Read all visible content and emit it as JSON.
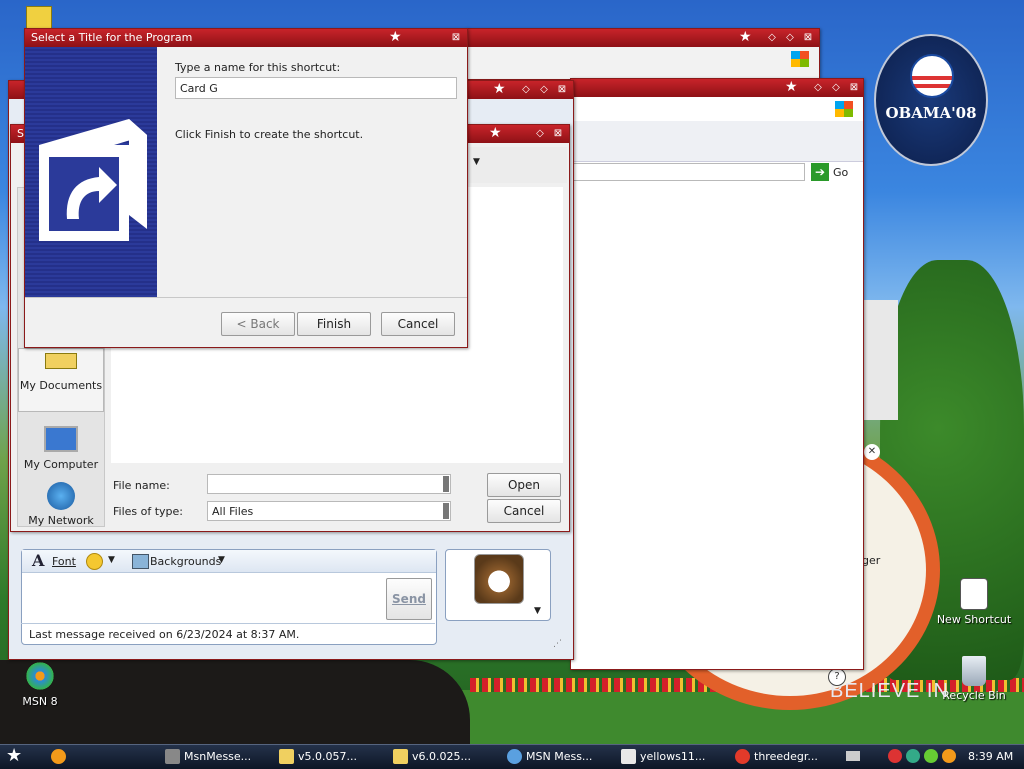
{
  "desktop": {
    "icons": [
      {
        "label": "MSN 8"
      },
      {
        "label": "New Shortcut"
      },
      {
        "label": "Recycle Bin"
      }
    ],
    "obama_badge": {
      "text": "OBAMA'08"
    },
    "side_text": "ger",
    "bottom_banner": "BELIEVE IN"
  },
  "wizard": {
    "title": "Select a Title for the Program",
    "prompt": "Type a name for this shortcut:",
    "name_value": "Card G",
    "hint": "Click Finish to create the shortcut.",
    "back_label": "< Back",
    "finish_label": "Finish",
    "cancel_label": "Cancel"
  },
  "browser": {
    "go_label": "Go"
  },
  "open_dialog": {
    "title_stub": "Se",
    "places": [
      {
        "label": "My Documents"
      },
      {
        "label": "My Computer"
      },
      {
        "label": "My Network"
      }
    ],
    "file_name_label": "File name:",
    "file_name_value": "",
    "files_of_type_label": "Files of type:",
    "files_of_type_value": "All Files",
    "open_label": "Open",
    "cancel_label": "Cancel"
  },
  "messenger": {
    "font_label": "Font",
    "backgrounds_label": "Backgrounds",
    "send_label": "Send",
    "status": "Last message received on 6/23/2024 at 8:37 AM."
  },
  "taskbar": {
    "items": [
      {
        "label": "MsnMesse..."
      },
      {
        "label": "v5.0.057..."
      },
      {
        "label": "v6.0.025..."
      },
      {
        "label": "MSN Mess..."
      },
      {
        "label": "yellows11..."
      },
      {
        "label": "threedegr..."
      }
    ],
    "clock": "8:39 AM"
  },
  "colors": {
    "titlebar": "#b01a20",
    "wizard_banner": "#2b3a9a",
    "taskbar": "#17233a"
  }
}
